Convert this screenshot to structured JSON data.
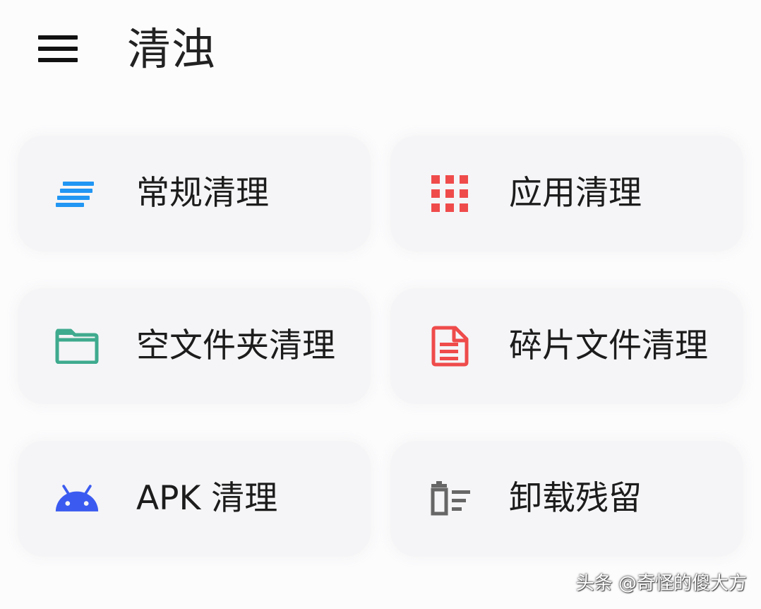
{
  "header": {
    "menu_icon": "hamburger-menu-icon",
    "title": "清浊"
  },
  "cards": [
    {
      "label": "常规清理",
      "icon": "lines-icon",
      "color": "#2196f3"
    },
    {
      "label": "应用清理",
      "icon": "grid-icon",
      "color": "#ef4b4b"
    },
    {
      "label": "空文件夹清理",
      "icon": "folder-icon",
      "color": "#3eaa8e"
    },
    {
      "label": "碎片文件清理",
      "icon": "document-icon",
      "color": "#ef4b4b"
    },
    {
      "label": "APK 清理",
      "icon": "android-icon",
      "color": "#3b5bf0"
    },
    {
      "label": "卸载残留",
      "icon": "trash-list-icon",
      "color": "#666666"
    }
  ],
  "watermark": "头条 @奇怪的傻大方"
}
